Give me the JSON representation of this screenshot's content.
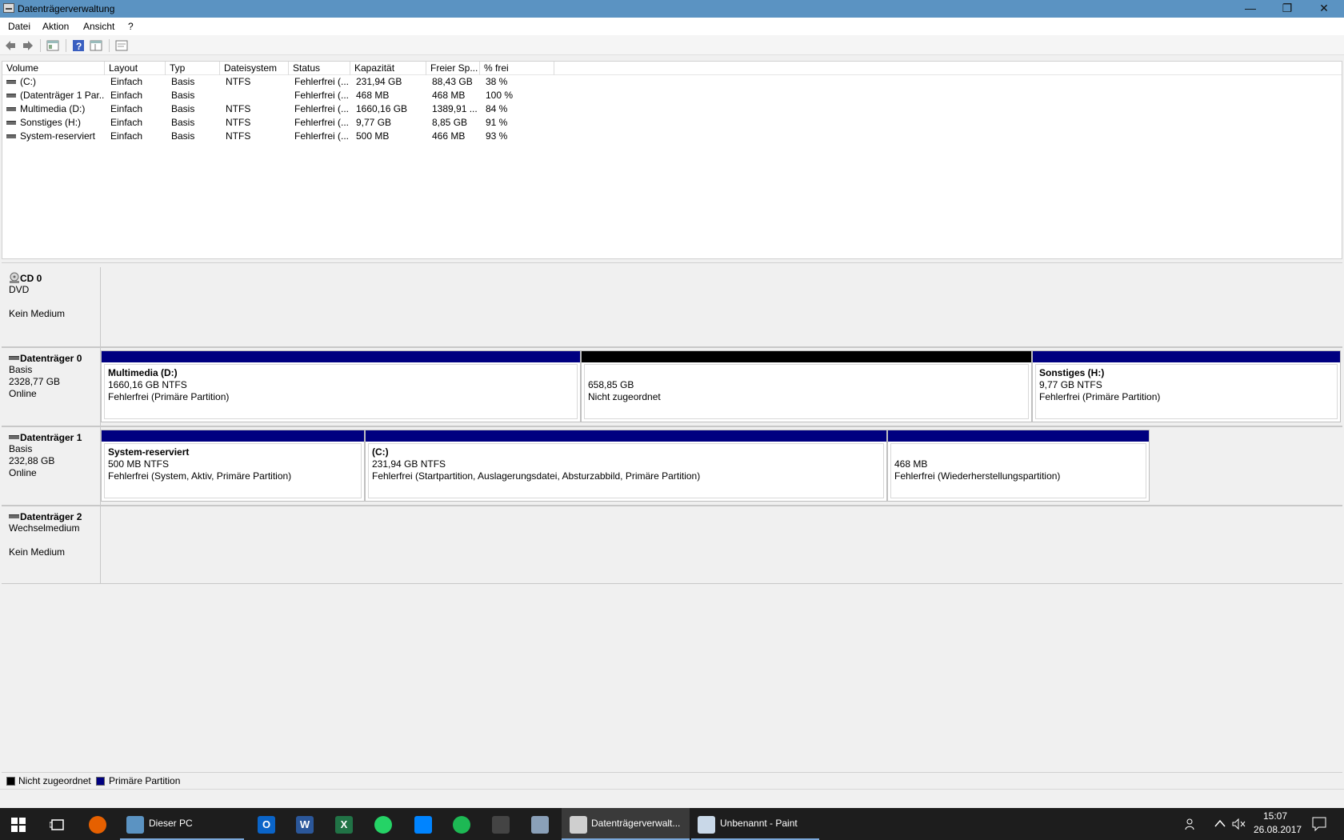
{
  "window": {
    "title": "Datenträgerverwaltung",
    "minimize": "—",
    "restore": "❐",
    "close": "✕"
  },
  "menu": {
    "items": [
      "Datei",
      "Aktion",
      "Ansicht",
      "?"
    ]
  },
  "toolbar": {
    "icons": [
      "back-icon",
      "forward-icon",
      "properties-icon",
      "help-icon",
      "view-icon",
      "console-icon"
    ]
  },
  "volumes": {
    "columns": [
      "Volume",
      "Layout",
      "Typ",
      "Dateisystem",
      "Status",
      "Kapazität",
      "Freier Sp...",
      "% frei"
    ],
    "rows": [
      [
        "(C:)",
        "Einfach",
        "Basis",
        "NTFS",
        "Fehlerfrei (...",
        "231,94 GB",
        "88,43 GB",
        "38 %"
      ],
      [
        "(Datenträger 1 Par...",
        "Einfach",
        "Basis",
        "",
        "Fehlerfrei (...",
        "468 MB",
        "468 MB",
        "100 %"
      ],
      [
        "Multimedia (D:)",
        "Einfach",
        "Basis",
        "NTFS",
        "Fehlerfrei (...",
        "1660,16 GB",
        "1389,91 ...",
        "84 %"
      ],
      [
        "Sonstiges (H:)",
        "Einfach",
        "Basis",
        "NTFS",
        "Fehlerfrei (...",
        "9,77 GB",
        "8,85 GB",
        "91 %"
      ],
      [
        "System-reserviert",
        "Einfach",
        "Basis",
        "NTFS",
        "Fehlerfrei (...",
        "500 MB",
        "466 MB",
        "93 %"
      ]
    ]
  },
  "disks": {
    "cd0": {
      "name": "CD 0",
      "type": "DVD",
      "status": "Kein Medium"
    },
    "disk0": {
      "name": "Datenträger 0",
      "type": "Basis",
      "size": "2328,77 GB",
      "status": "Online",
      "partitions": [
        {
          "name": "Multimedia  (D:)",
          "size": "1660,16 GB NTFS",
          "status": "Fehlerfrei (Primäre Partition)"
        },
        {
          "name": "",
          "size": "658,85 GB",
          "status": "Nicht zugeordnet"
        },
        {
          "name": "Sonstiges  (H:)",
          "size": "9,77 GB NTFS",
          "status": "Fehlerfrei (Primäre Partition)"
        }
      ]
    },
    "disk1": {
      "name": "Datenträger 1",
      "type": "Basis",
      "size": "232,88 GB",
      "status": "Online",
      "partitions": [
        {
          "name": "System-reserviert",
          "size": "500 MB NTFS",
          "status": "Fehlerfrei (System, Aktiv, Primäre Partition)"
        },
        {
          "name": " (C:)",
          "size": "231,94 GB NTFS",
          "status": "Fehlerfrei (Startpartition, Auslagerungsdatei, Absturzabbild, Primäre Partition)"
        },
        {
          "name": "",
          "size": "468 MB",
          "status": "Fehlerfrei (Wiederherstellungspartition)"
        }
      ]
    },
    "disk2": {
      "name": "Datenträger 2",
      "type": "Wechselmedium",
      "status": "Kein Medium"
    }
  },
  "legend": {
    "unallocated": "Nicht zugeordnet",
    "primary": "Primäre Partition"
  },
  "colors": {
    "primary": "#000080",
    "unallocated": "#000000",
    "titlebar": "#5b93c2"
  },
  "taskbar": {
    "pc_label": "Dieser PC",
    "diskmgmt_label": "Datenträgerverwalt...",
    "paint_label": "Unbenannt - Paint",
    "time": "15:07",
    "date": "26.08.2017"
  }
}
